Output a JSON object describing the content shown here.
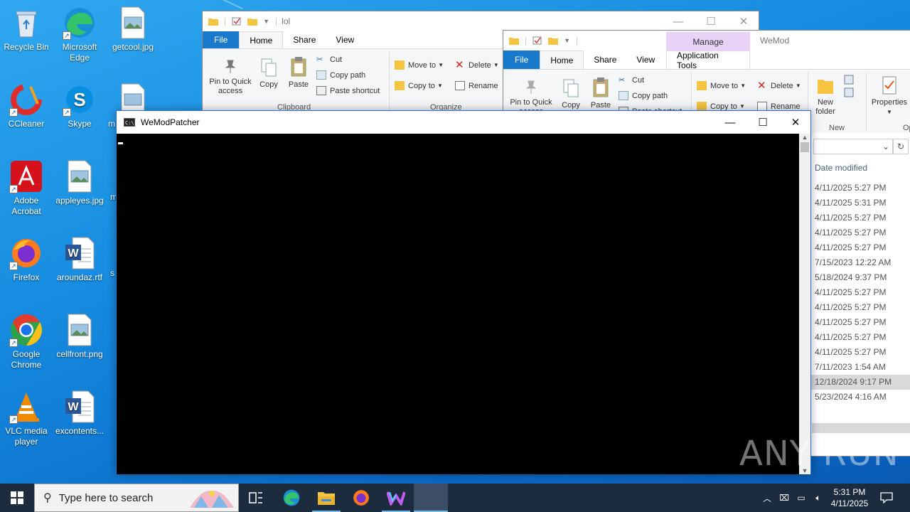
{
  "desktop": {
    "icons": [
      {
        "label": "Recycle Bin"
      },
      {
        "label": "Microsoft Edge"
      },
      {
        "label": "getcool.jpg"
      },
      {
        "label": "CCleaner"
      },
      {
        "label": "Skype"
      },
      {
        "label": "m"
      },
      {
        "label": "Adobe Acrobat"
      },
      {
        "label": "appleyes.jpg"
      },
      {
        "label": "m"
      },
      {
        "label": "Firefox"
      },
      {
        "label": "aroundaz.rtf"
      },
      {
        "label": "s"
      },
      {
        "label": "Google Chrome"
      },
      {
        "label": "cellfront.png"
      },
      {
        "label": "VLC media player"
      },
      {
        "label": "excontents..."
      }
    ]
  },
  "explorer1": {
    "title": "lol",
    "tabs": [
      "File",
      "Home",
      "Share",
      "View"
    ],
    "ribbon": {
      "pin": "Pin to Quick access",
      "copy": "Copy",
      "paste": "Paste",
      "cut": "Cut",
      "copy_path": "Copy path",
      "paste_shortcut": "Paste shortcut",
      "clipboard_group": "Clipboard",
      "move_to": "Move to",
      "copy_to": "Copy to",
      "delete": "Delete",
      "rename": "Rename",
      "organize_group": "Organize"
    }
  },
  "explorer2": {
    "title": "WeMod",
    "manage": "Manage",
    "app_tools": "Application Tools",
    "tabs": [
      "File",
      "Home",
      "Share",
      "View"
    ],
    "ribbon": {
      "pin": "Pin to Quick access",
      "copy": "Copy",
      "paste": "Paste",
      "cut": "Cut",
      "copy_path": "Copy path",
      "paste_shortcut": "Paste shortcut",
      "move_to": "Move to",
      "copy_to": "Copy to",
      "delete": "Delete",
      "rename": "Rename",
      "new_folder": "New folder",
      "new_group": "New",
      "properties": "Properties",
      "open_group": "Op"
    },
    "column_date": "Date modified",
    "dates": [
      "4/11/2025 5:27 PM",
      "4/11/2025 5:31 PM",
      "4/11/2025 5:27 PM",
      "4/11/2025 5:27 PM",
      "4/11/2025 5:27 PM",
      "7/15/2023 12:22 AM",
      "5/18/2024 9:37 PM",
      "4/11/2025 5:27 PM",
      "4/11/2025 5:27 PM",
      "4/11/2025 5:27 PM",
      "4/11/2025 5:27 PM",
      "4/11/2025 5:27 PM",
      "7/11/2023 1:54 AM",
      "12/18/2024 9:17 PM",
      "5/23/2024 4:16 AM"
    ],
    "selected_index": 13
  },
  "console": {
    "title": "WeModPatcher"
  },
  "taskbar": {
    "search_placeholder": "Type here to search",
    "time": "5:31 PM",
    "date": "4/11/2025"
  },
  "watermark": "ANY RUN",
  "colors": {
    "accent": "#1979ca",
    "manage": "#e8d3f7",
    "taskbar": "#1c2b3d"
  }
}
